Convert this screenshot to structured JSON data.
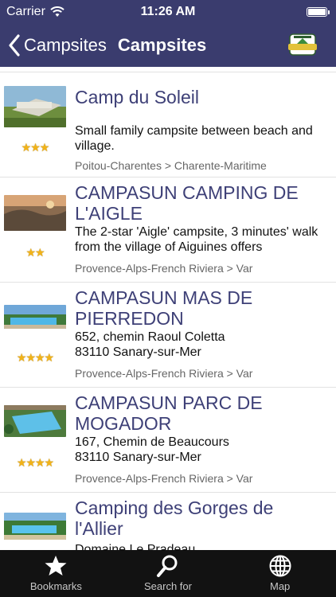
{
  "status": {
    "carrier": "Carrier",
    "time": "11:26 AM"
  },
  "nav": {
    "back_label": "Campsites",
    "title": "Campsites",
    "logo_icon": "camping-qualite-logo"
  },
  "campsites": [
    {
      "name": "Camp du Soleil",
      "stars": "★★★",
      "rating": 3,
      "description": "Small family campsite between beach and village.",
      "region": "Poitou-Charentes > Charente-Maritime"
    },
    {
      "name": "CAMPASUN CAMPING DE L'AIGLE",
      "stars": "★★",
      "rating": 2,
      "description": "The 2-star 'Aigle' campsite, 3 minutes' walk from the village of Aiguines offers",
      "region": "Provence-Alps-French Riviera > Var"
    },
    {
      "name": "CAMPASUN MAS DE PIERREDON",
      "stars": "★★★★",
      "rating": 4,
      "description": "652, chemin Raoul Coletta\n83110 Sanary-sur-Mer",
      "region": "Provence-Alps-French Riviera > Var"
    },
    {
      "name": "CAMPASUN PARC DE MOGADOR",
      "stars": "★★★★",
      "rating": 4,
      "description": "167, Chemin de Beaucours\n83110 Sanary-sur-Mer",
      "region": "Provence-Alps-French Riviera > Var"
    },
    {
      "name": "Camping  des Gorges de l'Allier",
      "stars": "",
      "rating": 0,
      "description": "Domaine Le Pradeau",
      "region": ""
    }
  ],
  "tabs": [
    {
      "label": "Bookmarks",
      "icon": "star-icon"
    },
    {
      "label": "Search for",
      "icon": "search-icon"
    },
    {
      "label": "Map",
      "icon": "globe-icon"
    }
  ],
  "colors": {
    "bar": "#3a3c6e",
    "title_text": "#3e4077",
    "stars": "#f2b318",
    "tab_bar": "#121212"
  }
}
